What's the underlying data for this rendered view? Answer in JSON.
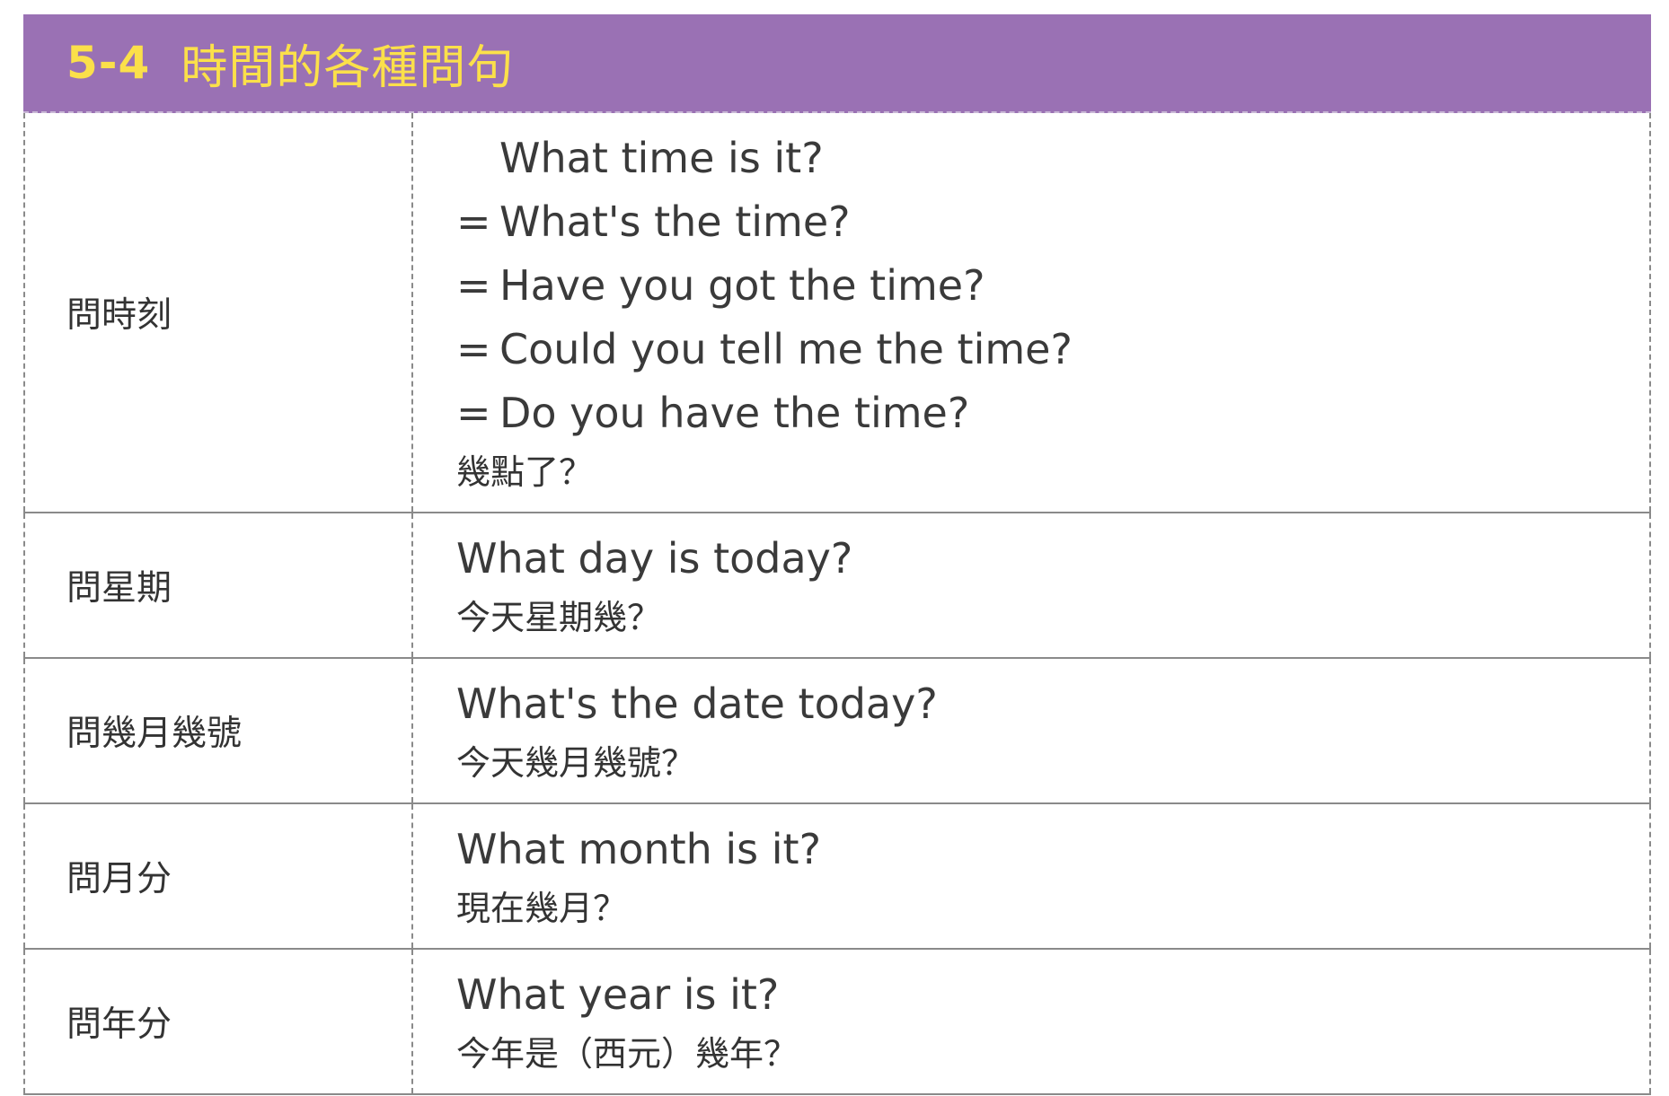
{
  "header": {
    "number": "5-4",
    "title": "時間的各種問句"
  },
  "rows": [
    {
      "category": "問時刻",
      "lines": [
        {
          "eq": "",
          "text": "What time is it?"
        },
        {
          "eq": "=",
          "text": "What's the time?"
        },
        {
          "eq": "=",
          "text": "Have you got the time?"
        },
        {
          "eq": "=",
          "text": "Could you tell me the time?"
        },
        {
          "eq": "=",
          "text": "Do you have the time?"
        }
      ],
      "translation": "幾點了？"
    },
    {
      "category": "問星期",
      "lines": [
        {
          "eq": "",
          "text": "What day is today?"
        }
      ],
      "translation": "今天星期幾？"
    },
    {
      "category": "問幾月幾號",
      "lines": [
        {
          "eq": "",
          "text": "What's the date today?"
        }
      ],
      "translation": "今天幾月幾號？"
    },
    {
      "category": "問月分",
      "lines": [
        {
          "eq": "",
          "text": "What month is it?"
        }
      ],
      "translation": "現在幾月？"
    },
    {
      "category": "問年分",
      "lines": [
        {
          "eq": "",
          "text": "What year is it?"
        }
      ],
      "translation": "今年是（西元）幾年？"
    }
  ]
}
